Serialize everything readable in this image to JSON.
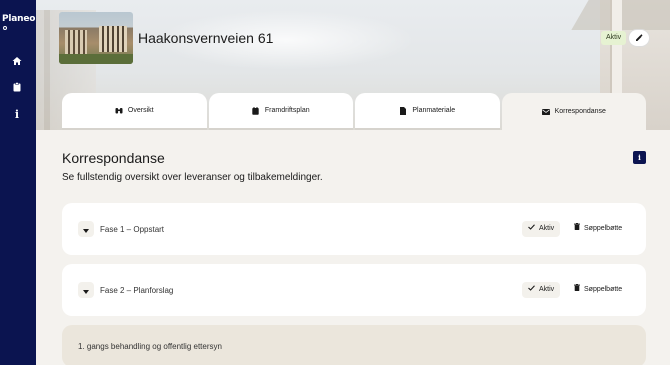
{
  "app": {
    "logo": "Planeo"
  },
  "sidebar": {
    "items": [
      {
        "icon": "home-icon"
      },
      {
        "icon": "clipboard-icon"
      },
      {
        "icon": "info-icon"
      }
    ]
  },
  "header": {
    "project_title": "Haakonsvernveien 61",
    "status": "Aktiv",
    "edit_icon": "pencil-icon"
  },
  "tabs": [
    {
      "label": "Oversikt",
      "icon": "binoculars-icon"
    },
    {
      "label": "Framdriftsplan",
      "icon": "calendar-icon"
    },
    {
      "label": "Planmateriale",
      "icon": "document-icon"
    },
    {
      "label": "Korrespondanse",
      "icon": "envelope-icon",
      "active": true
    }
  ],
  "main": {
    "title": "Korrespondanse",
    "subtitle": "Se fullstendig oversikt over leveranser og tilbakemeldinger.",
    "info_label": "i",
    "phases": [
      {
        "label": "Fase 1 – Oppstart",
        "status_label": "Aktiv",
        "trash_label": "Søppelbøtte"
      },
      {
        "label": "Fase 2 – Planforslag",
        "status_label": "Aktiv",
        "trash_label": "Søppelbøtte"
      }
    ],
    "subphase": {
      "label": "1. gangs behandling og offentlig ettersyn"
    }
  },
  "colors": {
    "sidebar": "#0b1450",
    "background": "#f4f2ee",
    "status_pill": "#e6f2d2",
    "subphase_bg": "#ebe6dc"
  }
}
